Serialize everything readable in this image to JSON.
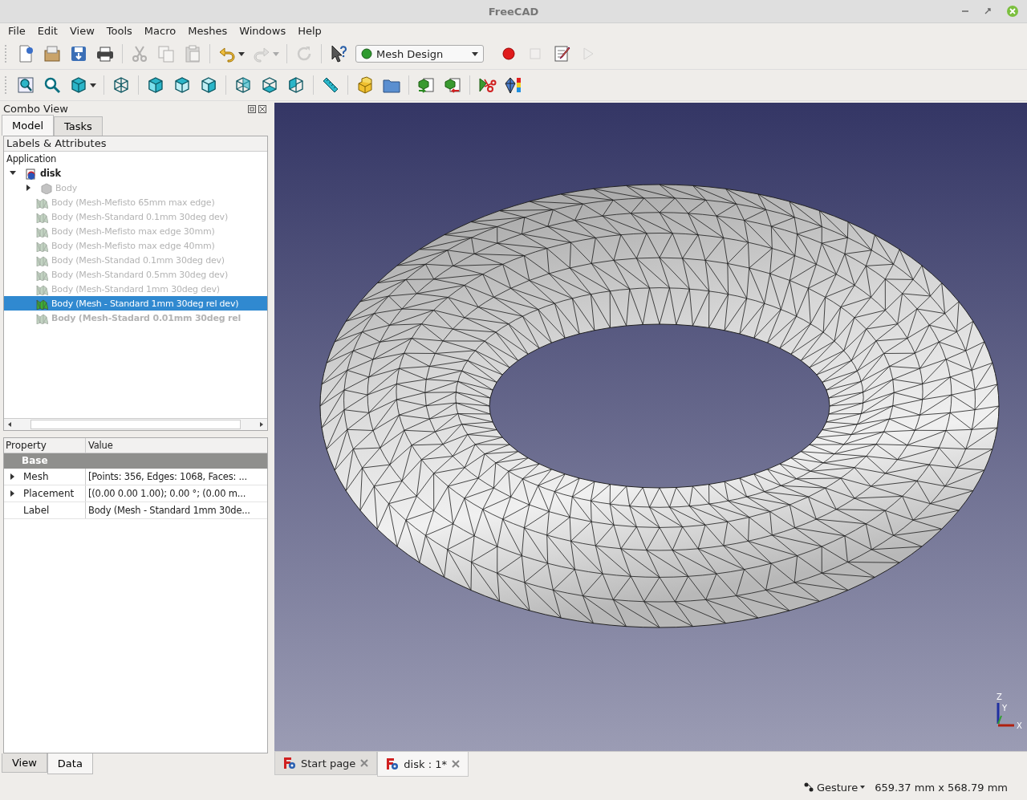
{
  "window": {
    "title": "FreeCAD"
  },
  "menu": [
    "File",
    "Edit",
    "View",
    "Tools",
    "Macro",
    "Meshes",
    "Windows",
    "Help"
  ],
  "toolbar_1": [
    {
      "kind": "new",
      "disabled": false
    },
    {
      "kind": "open",
      "disabled": false
    },
    {
      "kind": "save",
      "disabled": false
    },
    {
      "kind": "print",
      "disabled": false
    },
    {
      "kind": "sep"
    },
    {
      "kind": "cut",
      "disabled": true
    },
    {
      "kind": "copy",
      "disabled": true
    },
    {
      "kind": "paste",
      "disabled": true
    },
    {
      "kind": "sep"
    },
    {
      "kind": "undo",
      "disabled": false,
      "menu": true
    },
    {
      "kind": "redo",
      "disabled": true,
      "menu": true
    },
    {
      "kind": "sep"
    },
    {
      "kind": "refresh",
      "disabled": true
    },
    {
      "kind": "sep"
    },
    {
      "kind": "whatsthis",
      "disabled": false
    },
    {
      "kind": "workbench"
    },
    {
      "kind": "record",
      "disabled": false
    },
    {
      "kind": "stop",
      "disabled": true
    },
    {
      "kind": "macro",
      "disabled": false
    },
    {
      "kind": "play",
      "disabled": true
    }
  ],
  "workbench": {
    "value": "Mesh Design"
  },
  "toolbar_2": [
    {
      "kind": "zoomfit",
      "disabled": false
    },
    {
      "kind": "zoomsel",
      "disabled": false
    },
    {
      "kind": "cube",
      "disabled": false,
      "menu": true
    },
    {
      "kind": "sep"
    },
    {
      "kind": "iso",
      "disabled": false
    },
    {
      "kind": "sep"
    },
    {
      "kind": "front",
      "disabled": false
    },
    {
      "kind": "top",
      "disabled": false
    },
    {
      "kind": "right",
      "disabled": false
    },
    {
      "kind": "sep"
    },
    {
      "kind": "rear",
      "disabled": false
    },
    {
      "kind": "bottom",
      "disabled": false
    },
    {
      "kind": "left",
      "disabled": false
    },
    {
      "kind": "sep"
    },
    {
      "kind": "ruler",
      "disabled": false
    },
    {
      "kind": "sep"
    },
    {
      "kind": "part",
      "disabled": false
    },
    {
      "kind": "folder",
      "disabled": false
    },
    {
      "kind": "sep"
    },
    {
      "kind": "import",
      "disabled": false
    },
    {
      "kind": "export",
      "disabled": false
    },
    {
      "kind": "sep"
    },
    {
      "kind": "meshcut",
      "disabled": false
    },
    {
      "kind": "curvature",
      "disabled": false
    }
  ],
  "combo_view": {
    "title": "Combo View",
    "tabs": [
      {
        "label": "Model",
        "selected": true
      },
      {
        "label": "Tasks",
        "selected": false
      }
    ],
    "tree": {
      "header": "Labels & Attributes",
      "root": "Application",
      "children": [
        {
          "label": "disk",
          "kind": "document",
          "expanded": true,
          "selected": false,
          "children": [
            {
              "label": "Body",
              "kind": "body",
              "expanded": false,
              "hidden": true,
              "selected": false,
              "bold": false
            },
            {
              "label": "Body (Mesh-Mefisto 65mm max edge)",
              "kind": "mesh",
              "hidden": true,
              "selected": false,
              "bold": false
            },
            {
              "label": "Body (Mesh-Standard 0.1mm 30deg dev)",
              "kind": "mesh",
              "hidden": true,
              "selected": false,
              "bold": false
            },
            {
              "label": "Body (Mesh-Mefisto max edge 30mm)",
              "kind": "mesh",
              "hidden": true,
              "selected": false,
              "bold": false
            },
            {
              "label": "Body (Mesh-Mefisto max edge 40mm)",
              "kind": "mesh",
              "hidden": true,
              "selected": false,
              "bold": false
            },
            {
              "label": "Body (Mesh-Standad 0.1mm 30deg dev)",
              "kind": "mesh",
              "hidden": true,
              "selected": false,
              "bold": false
            },
            {
              "label": "Body (Mesh-Standard 0.5mm 30deg dev)",
              "kind": "mesh",
              "hidden": true,
              "selected": false,
              "bold": false
            },
            {
              "label": "Body (Mesh-Standard 1mm 30deg dev)",
              "kind": "mesh",
              "hidden": true,
              "selected": false,
              "bold": false
            },
            {
              "label": "Body (Mesh - Standard 1mm 30deg rel dev)",
              "kind": "mesh",
              "hidden": false,
              "selected": true,
              "bold": false
            },
            {
              "label": "Body (Mesh-Stadard 0.01mm 30deg rel",
              "kind": "mesh",
              "hidden": true,
              "selected": false,
              "bold": true
            }
          ]
        }
      ]
    },
    "properties": {
      "columns": [
        "Property",
        "Value"
      ],
      "group": "Base",
      "rows": [
        {
          "name": "Mesh",
          "value": "[Points: 356, Edges: 1068, Faces: ...",
          "expandable": true
        },
        {
          "name": "Placement",
          "value": "[(0.00 0.00 1.00); 0.00 °; (0.00 m...",
          "expandable": true
        },
        {
          "name": "Label",
          "value": "Body (Mesh - Standard 1mm 30de...",
          "expandable": false
        }
      ]
    },
    "bottom_tabs": [
      {
        "label": "View",
        "selected": false
      },
      {
        "label": "Data",
        "selected": true
      }
    ]
  },
  "viewport": {
    "axes": [
      "Z",
      "Y",
      "X"
    ]
  },
  "document_tabs": [
    {
      "label": "Start page",
      "selected": false
    },
    {
      "label": "disk : 1*",
      "selected": true
    }
  ],
  "status_bar": {
    "navigation": "Gesture",
    "dimensions": "659.37 mm x 568.79 mm"
  }
}
